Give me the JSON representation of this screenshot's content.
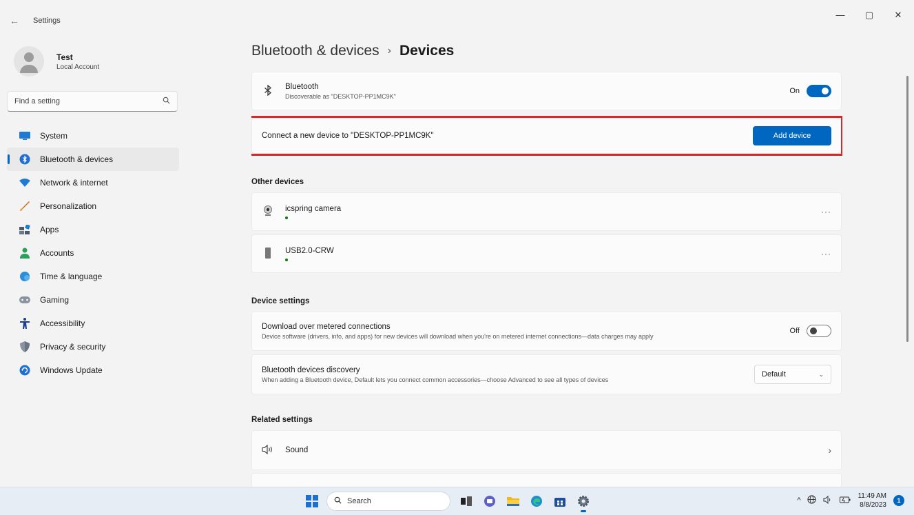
{
  "window": {
    "title": "Settings",
    "controls": {
      "minimize": "—",
      "maximize": "▢",
      "close": "✕"
    }
  },
  "profile": {
    "name": "Test",
    "account_type": "Local Account"
  },
  "search": {
    "placeholder": "Find a setting"
  },
  "nav": {
    "items": [
      {
        "label": "System",
        "icon": "system-icon"
      },
      {
        "label": "Bluetooth & devices",
        "icon": "bluetooth-icon",
        "active": true
      },
      {
        "label": "Network & internet",
        "icon": "wifi-icon"
      },
      {
        "label": "Personalization",
        "icon": "brush-icon"
      },
      {
        "label": "Apps",
        "icon": "apps-icon"
      },
      {
        "label": "Accounts",
        "icon": "person-icon"
      },
      {
        "label": "Time & language",
        "icon": "globe-clock-icon"
      },
      {
        "label": "Gaming",
        "icon": "gamepad-icon"
      },
      {
        "label": "Accessibility",
        "icon": "accessibility-icon"
      },
      {
        "label": "Privacy & security",
        "icon": "shield-icon"
      },
      {
        "label": "Windows Update",
        "icon": "update-icon"
      }
    ]
  },
  "breadcrumb": {
    "parent": "Bluetooth & devices",
    "separator": "›",
    "current": "Devices"
  },
  "bluetooth": {
    "title": "Bluetooth",
    "desc": "Discoverable as \"DESKTOP-PP1MC9K\"",
    "state_label": "On"
  },
  "connect": {
    "text": "Connect a new device to \"DESKTOP-PP1MC9K\"",
    "button": "Add device"
  },
  "other_devices": {
    "title": "Other devices",
    "items": [
      {
        "name": "icspring camera",
        "icon": "webcam-icon",
        "more": "···"
      },
      {
        "name": "USB2.0-CRW",
        "icon": "usb-drive-icon",
        "more": "···"
      }
    ]
  },
  "device_settings": {
    "title": "Device settings",
    "metered": {
      "title": "Download over metered connections",
      "desc": "Device software (drivers, info, and apps) for new devices will download when you're on metered internet connections—data charges may apply",
      "state_label": "Off"
    },
    "discovery": {
      "title": "Bluetooth devices discovery",
      "desc": "When adding a Bluetooth device, Default lets you connect common accessories—choose Advanced to see all types of devices",
      "selected": "Default"
    }
  },
  "related": {
    "title": "Related settings",
    "sound": {
      "label": "Sound",
      "icon": "speaker-icon"
    }
  },
  "taskbar": {
    "search_label": "Search",
    "time": "11:49 AM",
    "date": "8/8/2023",
    "notification_count": "1"
  },
  "colors": {
    "accent": "#0067c0",
    "highlight": "#d62828",
    "background": "#f3f3f3",
    "card": "#fbfbfb"
  }
}
